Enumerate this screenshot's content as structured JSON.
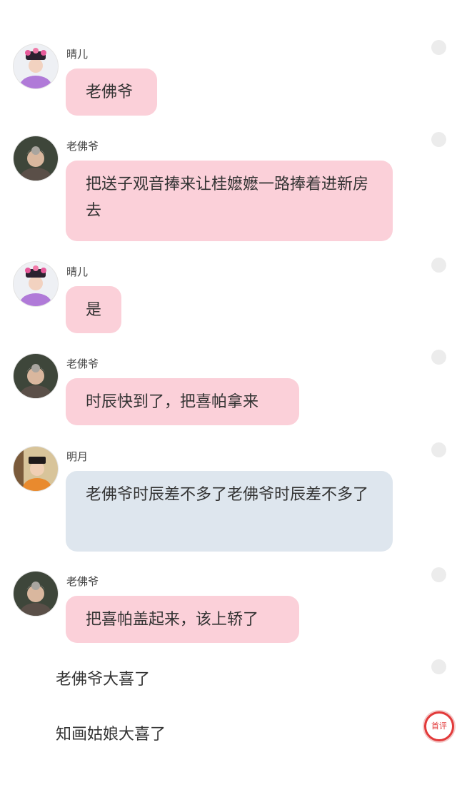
{
  "messages": [
    {
      "name": "晴儿",
      "text": "老佛爷",
      "style": "pink",
      "avatar": "qinger-avatar"
    },
    {
      "name": "老佛爷",
      "text": "把送子观音捧来让桂嬷嬷一路捧着进新房去",
      "style": "pink",
      "avatar": "laofoye-avatar"
    },
    {
      "name": "晴儿",
      "text": "是",
      "style": "pink",
      "avatar": "qinger-avatar"
    },
    {
      "name": "老佛爷",
      "text": "时辰快到了，把喜帕拿来",
      "style": "pink",
      "avatar": "laofoye-avatar"
    },
    {
      "name": "明月",
      "text": "老佛爷时辰差不多了老佛爷时辰差不多了",
      "style": "blue",
      "avatar": "mingyue-avatar"
    },
    {
      "name": "老佛爷",
      "text": "把喜帕盖起来，该上轿了",
      "style": "pink",
      "avatar": "laofoye-avatar"
    }
  ],
  "plain_lines": [
    "老佛爷大喜了",
    "知画姑娘大喜了"
  ],
  "badge": {
    "label": "首评"
  },
  "colors": {
    "pink_bubble": "#fbd0d9",
    "blue_bubble": "#dee6ee",
    "badge_red": "#e23a3a",
    "side_dot": "#ececec"
  }
}
